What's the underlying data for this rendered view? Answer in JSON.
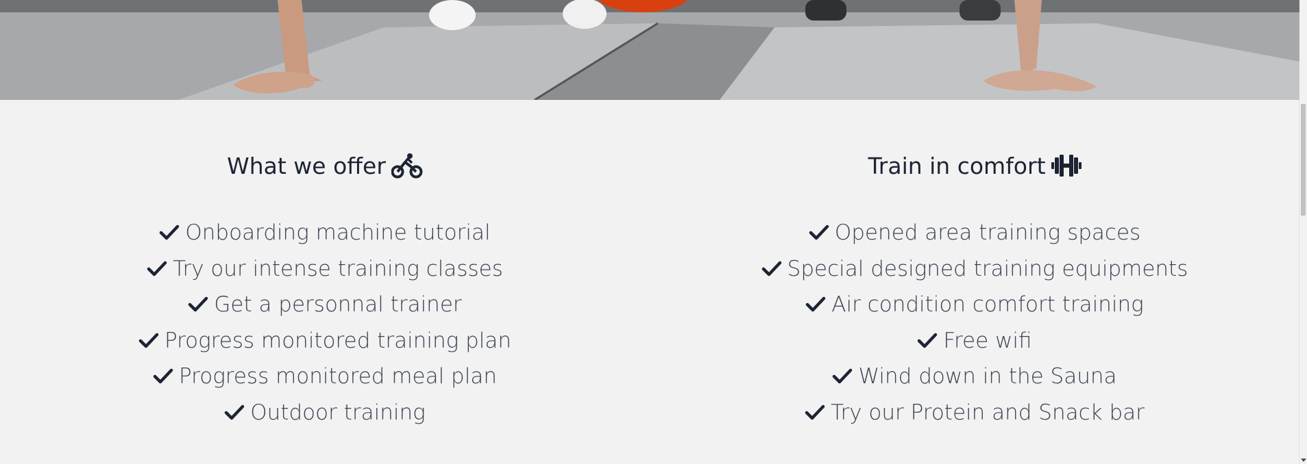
{
  "hero": {
    "image_description_icon": "gym-pushup-image"
  },
  "offer": {
    "title": "What we offer",
    "icon": "bicycle-icon",
    "items": [
      "Onboarding machine tutorial",
      "Try our intense training classes",
      "Get a personnal trainer",
      "Progress monitored training plan",
      "Progress monitored meal plan",
      "Outdoor training"
    ]
  },
  "comfort": {
    "title": "Train in comfort",
    "icon": "dumbbell-icon",
    "items": [
      "Opened area training spaces",
      "Special designed training equipments",
      "Air condition comfort training",
      "Free wifi",
      "Wind down in the Sauna",
      "Try our Protein and Snack bar"
    ]
  },
  "colors": {
    "background": "#f2f2f2",
    "heading": "#1c2433",
    "text": "#3b4252",
    "accent": "#d9400f"
  }
}
